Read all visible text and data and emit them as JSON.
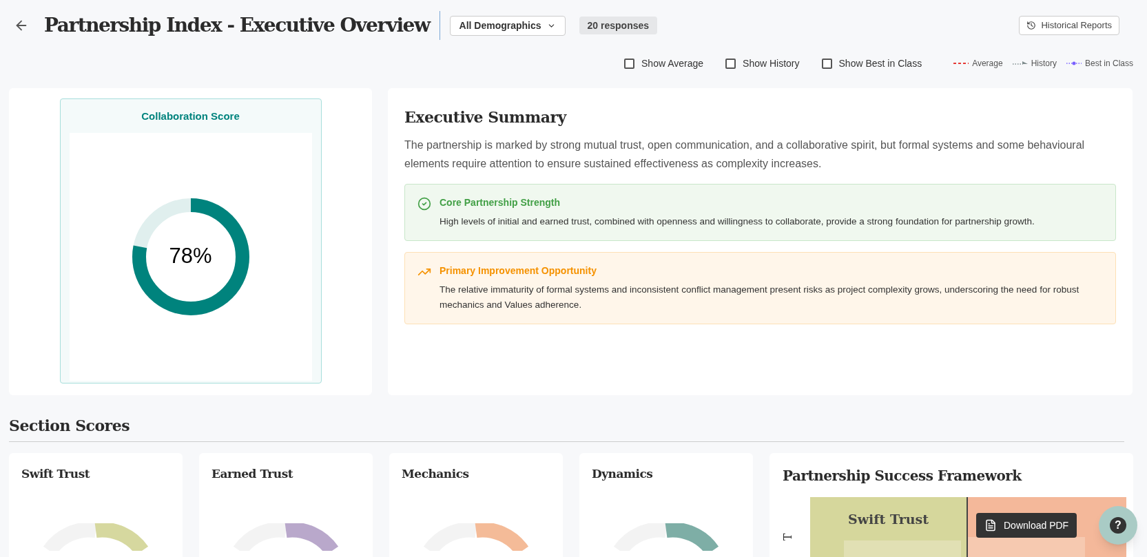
{
  "header": {
    "title": "Partnership Index - Executive Overview",
    "demographics": "All Demographics",
    "responses": "20 responses",
    "historical_button": "Historical Reports"
  },
  "toggles": [
    {
      "label": "Show Average",
      "checked": false
    },
    {
      "label": "Show History",
      "checked": false
    },
    {
      "label": "Show Best in Class",
      "checked": false
    }
  ],
  "legend": [
    {
      "kind": "dashed",
      "label": "Average",
      "color": "#e53935"
    },
    {
      "kind": "arrow",
      "label": "History",
      "color": "#7f8c8d"
    },
    {
      "kind": "dotted",
      "label": "Best in Class",
      "color": "#7b61ff"
    }
  ],
  "score_card": {
    "title": "Collaboration Score",
    "value": "78%",
    "level": 0.78
  },
  "summary": {
    "title": "Executive Summary",
    "text": "The partnership is marked by strong mutual trust, open communication, and a collaborative spirit, but formal systems and some behavioural elements require attention to ensure sustained effectiveness as complexity increases.",
    "callouts": [
      {
        "kind": "strength",
        "title": "Core Partnership Strength",
        "text": "High levels of initial and earned trust, combined with openness and willingness to collaborate, provide a strong foundation for partnership growth."
      },
      {
        "kind": "opportunity",
        "title": "Primary Improvement Opportunity",
        "text": "The relative immaturity of formal systems and inconsistent conflict management present risks as project complexity grows, underscoring the need for robust mechanics and Values adherence."
      }
    ]
  },
  "section_scores": {
    "title": "Section Scores",
    "sections": [
      {
        "name": "Swift Trust",
        "color": "#d6d89f"
      },
      {
        "name": "Earned Trust",
        "color": "#b9a8cb"
      },
      {
        "name": "Mechanics",
        "color": "#f4bb98"
      },
      {
        "name": "Dynamics",
        "color": "#7eaea6"
      }
    ]
  },
  "framework": {
    "title": "Partnership Success Framework",
    "axis_label": "T",
    "quadrant": "Swift Trust"
  },
  "download_button": "Download PDF",
  "help_button": "?"
}
